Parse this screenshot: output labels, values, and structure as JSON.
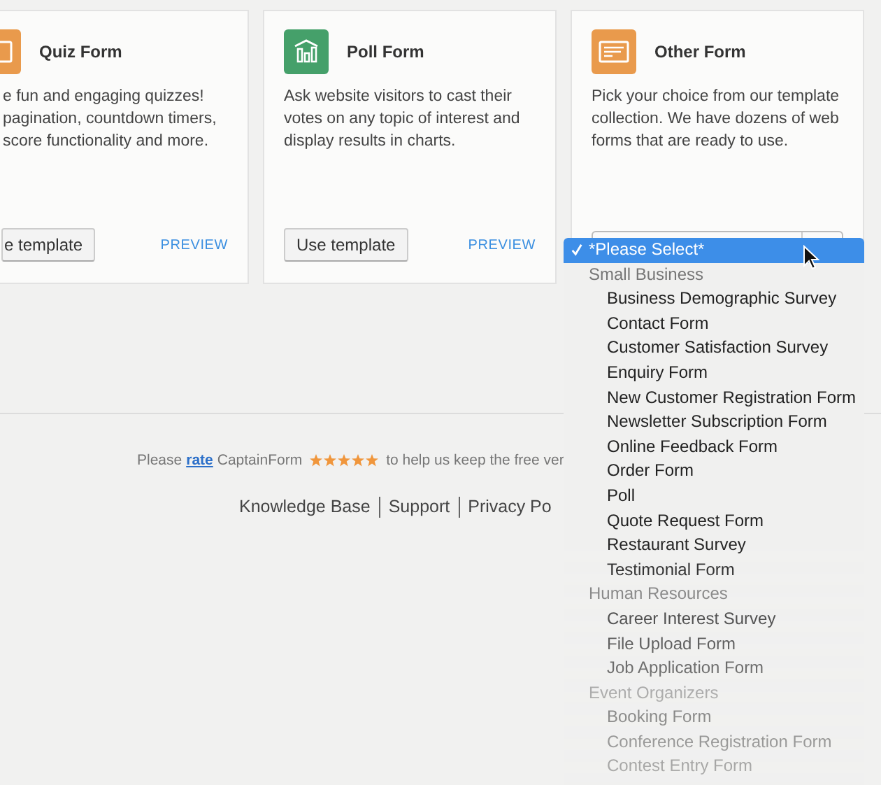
{
  "cards": [
    {
      "title": "Quiz Form",
      "lines": [
        "e fun and engaging quizzes!",
        "pagination, countdown timers,",
        "score functionality and more."
      ],
      "action": "e template",
      "preview": "PREVIEW"
    },
    {
      "title": "Poll Form",
      "lines": [
        "Ask website visitors to cast their",
        "votes on any topic of interest and",
        "display results in charts."
      ],
      "action": "Use template",
      "preview": "PREVIEW"
    },
    {
      "title": "Other Form",
      "lines": [
        "Pick your choice from our template",
        "collection. We have dozens of web",
        "forms that are ready to use."
      ],
      "select": true
    }
  ],
  "dropdown": {
    "options": [
      {
        "label": "*Please Select*",
        "selected": true
      }
    ],
    "groups": [
      {
        "label": "Small Business",
        "options": [
          {
            "label": "Business Demographic Survey",
            "selected": false
          },
          {
            "label": "Contact Form",
            "selected": false
          },
          {
            "label": "Customer Satisfaction Survey",
            "selected": false
          },
          {
            "label": "Enquiry Form",
            "selected": false
          },
          {
            "label": "New Customer Registration Form",
            "selected": false
          },
          {
            "label": "Newsletter Subscription Form",
            "selected": false
          },
          {
            "label": "Online Feedback Form",
            "selected": false
          },
          {
            "label": "Order Form",
            "selected": false
          },
          {
            "label": "Poll",
            "selected": false
          },
          {
            "label": "Quote Request Form",
            "selected": false
          },
          {
            "label": "Restaurant Survey",
            "selected": false
          },
          {
            "label": "Testimonial Form",
            "selected": false
          }
        ]
      },
      {
        "label": "Human Resources",
        "options": [
          {
            "label": "Career Interest Survey",
            "selected": false
          },
          {
            "label": "File Upload Form",
            "selected": false
          },
          {
            "label": "Job Application Form",
            "selected": false
          }
        ]
      },
      {
        "label": "Event Organizers",
        "options": [
          {
            "label": "Booking Form",
            "selected": false
          },
          {
            "label": "Conference Registration Form",
            "selected": false
          },
          {
            "label": "Contest Entry Form",
            "selected": false
          }
        ]
      }
    ]
  },
  "footer": {
    "rating": {
      "before": "Please",
      "link": "rate",
      "product": "CaptainForm",
      "stars": 5,
      "after": "to help us keep the free ver"
    },
    "links": [
      "Knowledge Base",
      "Support",
      "Privacy Po"
    ]
  }
}
